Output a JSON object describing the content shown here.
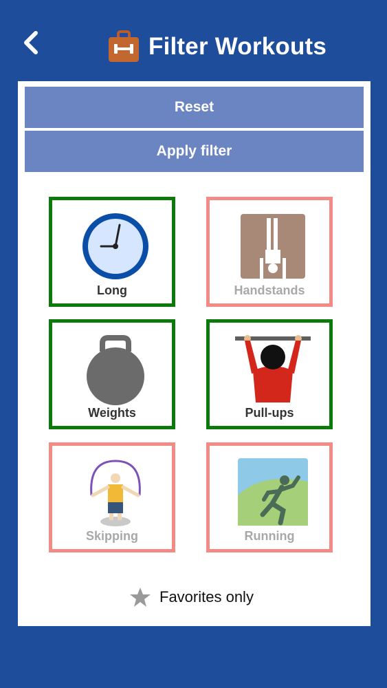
{
  "header": {
    "title": "Filter Workouts",
    "back_icon": "chevron-left-icon",
    "title_icon": "briefcase-dumbbell-icon"
  },
  "actions": {
    "reset_label": "Reset",
    "apply_label": "Apply filter"
  },
  "workouts": [
    {
      "label": "Long",
      "selected": true,
      "icon": "clock-icon"
    },
    {
      "label": "Handstands",
      "selected": false,
      "icon": "handstand-icon"
    },
    {
      "label": "Weights",
      "selected": true,
      "icon": "kettlebell-icon"
    },
    {
      "label": "Pull-ups",
      "selected": true,
      "icon": "pullup-icon"
    },
    {
      "label": "Skipping",
      "selected": false,
      "icon": "jump-rope-icon"
    },
    {
      "label": "Running",
      "selected": false,
      "icon": "runner-icon"
    }
  ],
  "favorites": {
    "label": "Favorites only",
    "checked": false,
    "icon": "star-icon"
  },
  "colors": {
    "background": "#1e4d9b",
    "button": "#6a85c1",
    "selected_border": "#0b7a0b",
    "unselected_border": "#f28a86"
  }
}
